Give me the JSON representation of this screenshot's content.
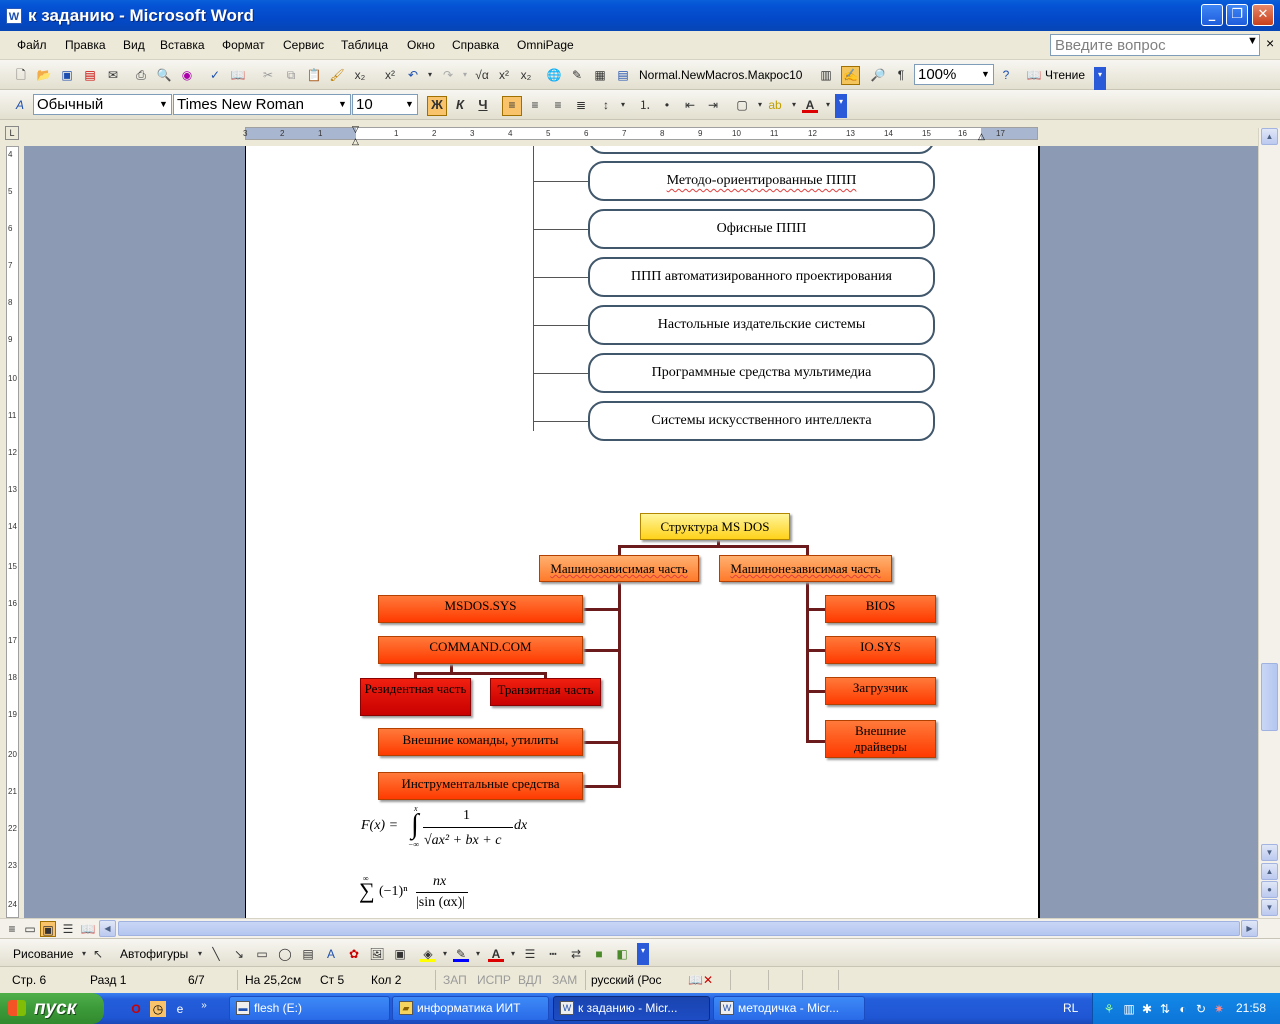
{
  "window": {
    "title": "к заданию - Microsoft Word",
    "app_icon": "W",
    "minimize": "_",
    "maximize": "❐",
    "close": "✕"
  },
  "menu": {
    "items": [
      "Файл",
      "Правка",
      "Вид",
      "Вставка",
      "Формат",
      "Сервис",
      "Таблица",
      "Окно",
      "Справка",
      "OmniPage"
    ],
    "ask_placeholder": "Введите вопрос",
    "close_doc": "×"
  },
  "standard_toolbar": {
    "macro_label": "Normal.NewMacros.Макрос10",
    "zoom": "100%",
    "reading_label": "Чтение"
  },
  "format_toolbar": {
    "style": "Обычный",
    "font": "Times New Roman",
    "size": "10",
    "bold": "Ж",
    "italic": "К",
    "underline": "Ч"
  },
  "ruler": {
    "numbers": [
      "3",
      "2",
      "1",
      "1",
      "2",
      "3",
      "4",
      "5",
      "6",
      "7",
      "8",
      "9",
      "10",
      "11",
      "12",
      "13",
      "14",
      "15",
      "16",
      "17"
    ]
  },
  "vruler": {
    "numbers": [
      "4",
      "5",
      "6",
      "7",
      "8",
      "9",
      "10",
      "11",
      "12",
      "13",
      "14",
      "15",
      "16",
      "17",
      "18",
      "19",
      "20",
      "21",
      "22",
      "23",
      "24"
    ]
  },
  "document": {
    "list_boxes": [
      "",
      "Методо-ориентированные ППП",
      "Офисные ППП",
      "ППП автоматизированного проектирования",
      "Настольные издательские системы",
      "Программные средства мультимедиа",
      "Системы искусственного интеллекта"
    ],
    "msdos": {
      "root": "Структура MS DOS",
      "left_branch": "Машинозависимая часть",
      "right_branch": "Машинонезависимая часть",
      "left_items": [
        "MSDOS.SYS",
        "COMMAND.COM",
        "Внешние команды, утилиты",
        "Инструментальные средства"
      ],
      "command_children": [
        "Резидентная часть",
        "Транзитная часть"
      ],
      "right_items": [
        "BIOS",
        "IO.SYS",
        "Загрузчик",
        "Внешние драйверы"
      ]
    },
    "formula1": {
      "lhs": "F(x) =",
      "upper": "x",
      "lower": "−∞",
      "numerator": "1",
      "denominator": "√ax² + bx + c",
      "dx": "dx"
    },
    "formula2": {
      "sum_upper": "∞",
      "term": "(−1)ⁿ",
      "numerator": "nx",
      "denominator": "|sin (αx)|"
    }
  },
  "drawing_toolbar": {
    "draw_label": "Рисование",
    "autoshapes_label": "Автофигуры"
  },
  "status": {
    "page": "Стр. 6",
    "section": "Разд 1",
    "pages": "6/7",
    "at": "На 25,2см",
    "line": "Ст 5",
    "col": "Кол 2",
    "rec": "ЗАП",
    "trk": "ИСПР",
    "ext": "ВДЛ",
    "ovr": "ЗАМ",
    "lang": "русский (Рос"
  },
  "taskbar": {
    "start": "пуск",
    "tasks": [
      "flesh (E:)",
      "информатика ИИТ",
      "к заданию - Micr...",
      "методичка - Micr..."
    ],
    "lang": "RL",
    "clock": "21:58"
  }
}
